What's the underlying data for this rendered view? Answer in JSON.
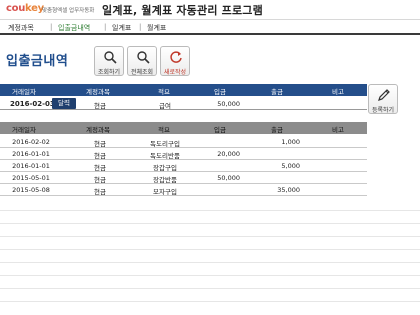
{
  "app": {
    "logo_main": "cou",
    "logo_accent": "key",
    "logo_sub": "맞춤형엑셀 업무자동화",
    "title": "일계표, 월계표 자동관리 프로그램"
  },
  "menu": {
    "items": [
      {
        "label": "계정과목"
      },
      {
        "label": "입출금내역"
      },
      {
        "label": "일계표"
      },
      {
        "label": "월계표"
      }
    ],
    "separator": "|"
  },
  "page": {
    "title": "입출금내역"
  },
  "toolbar": {
    "search_label": "조회하기",
    "search_all_label": "전체조회",
    "reset_label": "새로작성",
    "register_label": "등록하기"
  },
  "columns": [
    "거래일자",
    "계정과목",
    "적요",
    "입금",
    "출금",
    "비고"
  ],
  "entry": {
    "date": "2016-02-03",
    "calendar_label": "달력",
    "account": "현금",
    "memo": "급여",
    "deposit": "50,000",
    "withdrawal": "",
    "note": ""
  },
  "rows": [
    {
      "date": "2016-02-02",
      "account": "현금",
      "memo": "독도리구입",
      "deposit": "",
      "withdrawal": "1,000",
      "note": ""
    },
    {
      "date": "2016-01-01",
      "account": "현금",
      "memo": "독도리반품",
      "deposit": "20,000",
      "withdrawal": "",
      "note": ""
    },
    {
      "date": "2016-01-01",
      "account": "현금",
      "memo": "장갑구입",
      "deposit": "",
      "withdrawal": "5,000",
      "note": ""
    },
    {
      "date": "2015-05-01",
      "account": "현금",
      "memo": "장갑반품",
      "deposit": "50,000",
      "withdrawal": "",
      "note": ""
    },
    {
      "date": "2015-05-08",
      "account": "현금",
      "memo": "모자구입",
      "deposit": "",
      "withdrawal": "35,000",
      "note": ""
    }
  ],
  "colors": {
    "header_blue": "#244e8a",
    "header_gray": "#8c8c8c",
    "title_blue": "#1f4d8c",
    "active_menu": "#2e7d32"
  }
}
